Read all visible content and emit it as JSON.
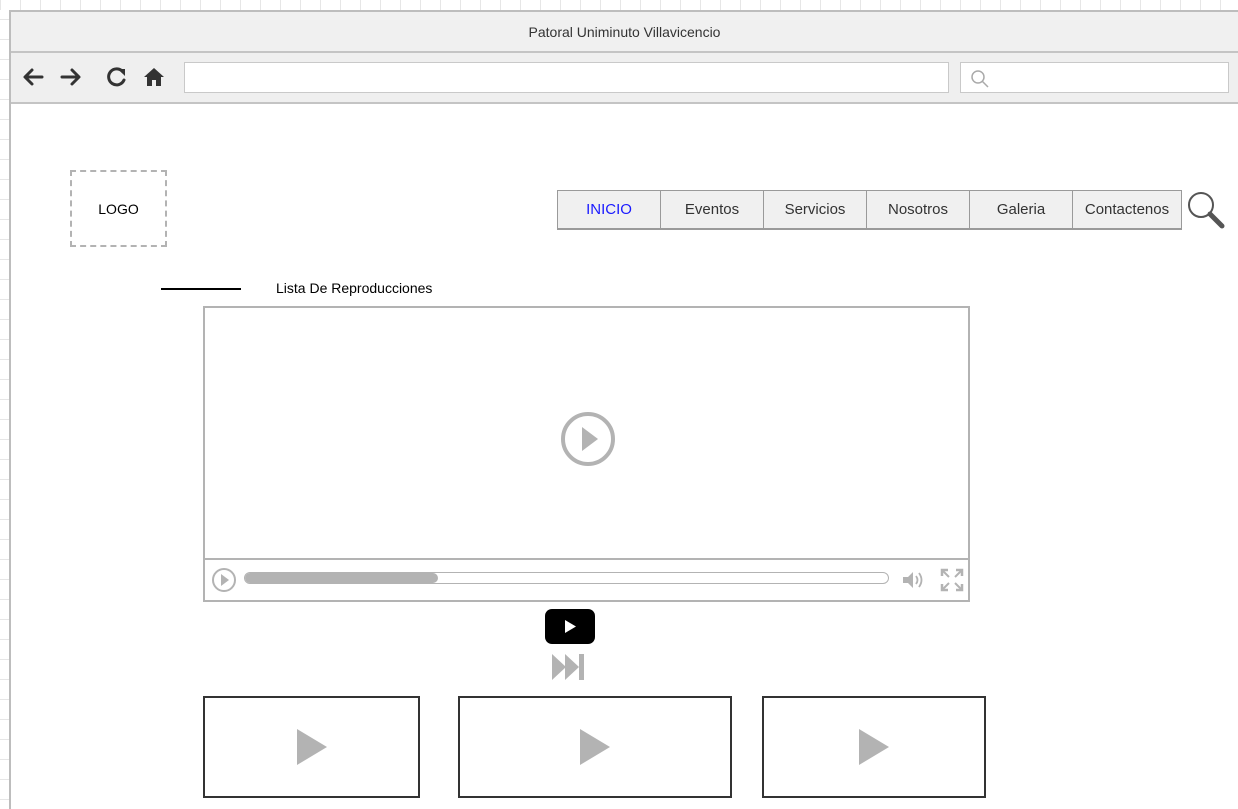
{
  "window": {
    "title": "Patoral Uniminuto Villavicencio"
  },
  "browser": {
    "url_value": "",
    "search_value": ""
  },
  "header": {
    "logo_text": "LOGO",
    "nav": [
      {
        "label": "INICIO",
        "active": true
      },
      {
        "label": "Eventos",
        "active": false
      },
      {
        "label": "Servicios",
        "active": false
      },
      {
        "label": "Nosotros",
        "active": false
      },
      {
        "label": "Galeria",
        "active": false
      },
      {
        "label": "Contactenos",
        "active": false
      }
    ],
    "search_icon": "search-icon"
  },
  "playlist": {
    "label": "Lista De Reproducciones"
  },
  "player": {
    "progress_fraction": 0.3,
    "icons": [
      "play-icon",
      "volume-icon",
      "fullscreen-icon"
    ]
  },
  "below_player": {
    "icons": [
      "youtube-icon",
      "skip-next-icon"
    ]
  },
  "thumbnails": [
    {
      "icon": "play-icon"
    },
    {
      "icon": "play-icon"
    },
    {
      "icon": "play-icon"
    }
  ],
  "colors": {
    "active_nav": "#1a1aff",
    "chrome_bg": "#f0f0f0",
    "wire_gray": "#b3b3b3"
  }
}
